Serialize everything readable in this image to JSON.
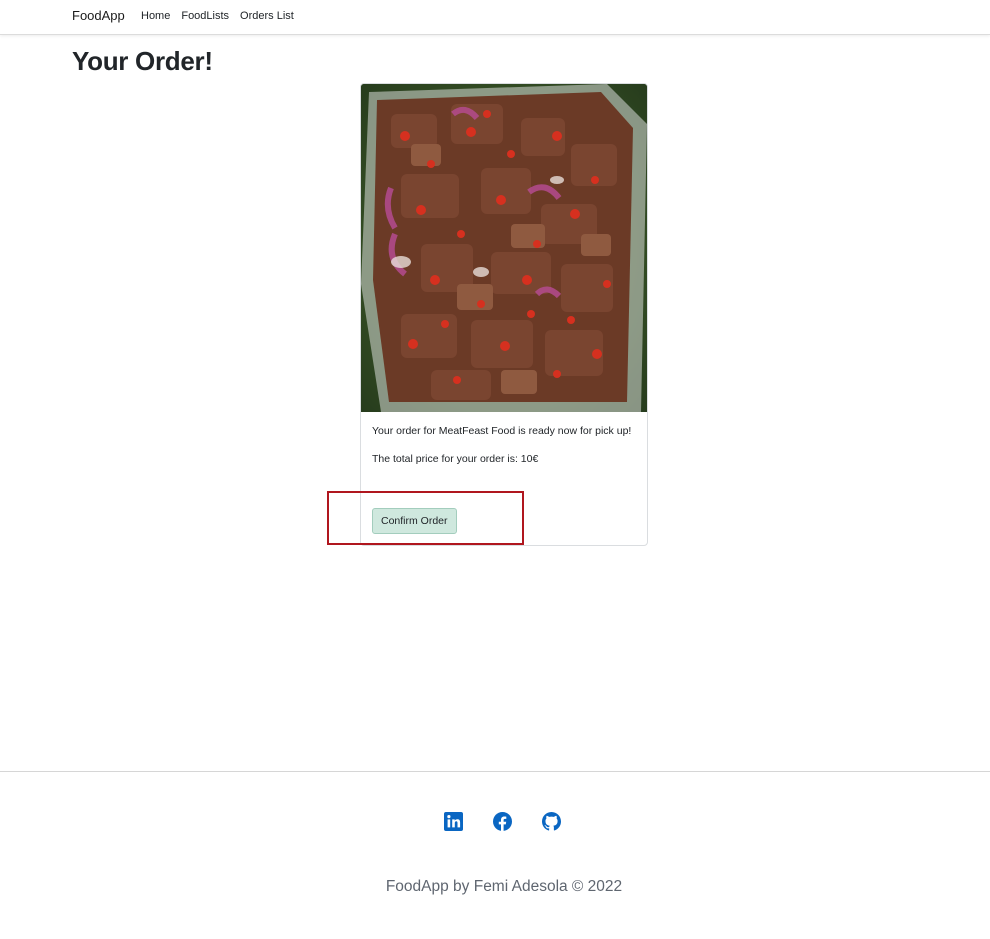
{
  "navbar": {
    "brand": "FoodApp",
    "links": [
      "Home",
      "FoodLists",
      "Orders List"
    ]
  },
  "page": {
    "title": "Your Order!"
  },
  "order": {
    "message": "Your order for MeatFeast Food is ready now for pick up!",
    "price_text": "The total price for your order is: 10€",
    "confirm_label": "Confirm Order",
    "image_icon": "food-photo"
  },
  "footer": {
    "socials": [
      "linkedin-icon",
      "facebook-icon",
      "github-icon"
    ],
    "copyright": "FoodApp by Femi Adesola © 2022"
  },
  "colors": {
    "social_blue": "#0a66c2",
    "button_bg": "#cfe8de",
    "highlight": "#b0161e"
  }
}
